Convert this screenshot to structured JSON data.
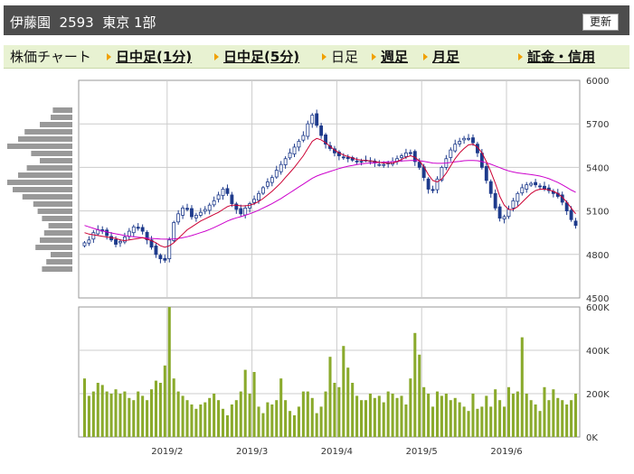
{
  "header": {
    "title": "伊藤園  2593  東京 1部",
    "refresh_label": "更新"
  },
  "nav": {
    "chart_label": "株価チャート",
    "items": [
      {
        "label": "日中足(1分)",
        "link": true
      },
      {
        "label": "日中足(5分)",
        "link": true
      },
      {
        "label": "日足",
        "link": false
      },
      {
        "label": "週足",
        "link": true
      },
      {
        "label": "月足",
        "link": true
      },
      {
        "label": "証金・信用",
        "link": true
      }
    ]
  },
  "colors": {
    "up": "#ffffff",
    "down": "#1e3b8c",
    "ma_short": "#cc0033",
    "ma_long": "#cc00cc",
    "volume": "#8aaa2c",
    "profile": "#999999",
    "grid": "#cccccc"
  },
  "chart_data": {
    "type": "candlestick",
    "x_labels": [
      "2019/2",
      "2019/3",
      "2019/4",
      "2019/5",
      "2019/6"
    ],
    "price_axis": {
      "min": 4500,
      "max": 6000,
      "ticks": [
        6000,
        5700,
        5400,
        5100,
        4800,
        4500
      ]
    },
    "volume_axis": {
      "min": 0,
      "max": 600000,
      "tick_labels": [
        "600K",
        "400K",
        "200K",
        "0K"
      ]
    },
    "price_close": [
      4880,
      4900,
      4950,
      4970,
      4960,
      4930,
      4900,
      4870,
      4890,
      4920,
      4960,
      4990,
      4980,
      4960,
      4900,
      4850,
      4800,
      4770,
      4760,
      4900,
      5020,
      5080,
      5120,
      5110,
      5060,
      5070,
      5090,
      5110,
      5140,
      5170,
      5210,
      5250,
      5220,
      5150,
      5110,
      5080,
      5120,
      5150,
      5180,
      5220,
      5260,
      5300,
      5330,
      5380,
      5420,
      5460,
      5500,
      5540,
      5580,
      5620,
      5700,
      5760,
      5690,
      5620,
      5560,
      5530,
      5500,
      5480,
      5470,
      5460,
      5450,
      5440,
      5440,
      5450,
      5440,
      5430,
      5420,
      5420,
      5430,
      5440,
      5460,
      5480,
      5500,
      5500,
      5440,
      5400,
      5330,
      5250,
      5240,
      5320,
      5400,
      5460,
      5520,
      5560,
      5580,
      5600,
      5600,
      5570,
      5500,
      5400,
      5310,
      5220,
      5120,
      5050,
      5060,
      5110,
      5170,
      5220,
      5260,
      5280,
      5290,
      5280,
      5270,
      5250,
      5240,
      5220,
      5200,
      5160,
      5100,
      5040,
      5000
    ],
    "ma_short": [
      4950,
      4940,
      4935,
      4930,
      4925,
      4920,
      4915,
      4910,
      4900,
      4895,
      4900,
      4905,
      4910,
      4915,
      4905,
      4895,
      4880,
      4860,
      4850,
      4860,
      4880,
      4910,
      4940,
      4970,
      4990,
      5010,
      5030,
      5045,
      5060,
      5075,
      5090,
      5110,
      5130,
      5140,
      5140,
      5135,
      5135,
      5140,
      5150,
      5165,
      5185,
      5210,
      5235,
      5265,
      5295,
      5330,
      5365,
      5400,
      5440,
      5480,
      5530,
      5580,
      5600,
      5590,
      5570,
      5545,
      5520,
      5500,
      5485,
      5475,
      5465,
      5455,
      5450,
      5448,
      5445,
      5440,
      5435,
      5430,
      5428,
      5430,
      5440,
      5455,
      5470,
      5480,
      5470,
      5445,
      5405,
      5350,
      5310,
      5300,
      5320,
      5360,
      5410,
      5460,
      5500,
      5530,
      5555,
      5560,
      5540,
      5500,
      5440,
      5370,
      5290,
      5200,
      5140,
      5110,
      5110,
      5130,
      5160,
      5190,
      5220,
      5240,
      5250,
      5250,
      5245,
      5235,
      5220,
      5195,
      5160,
      5120,
      5080
    ],
    "ma_long": [
      5000,
      4990,
      4980,
      4970,
      4962,
      4955,
      4948,
      4942,
      4936,
      4930,
      4926,
      4922,
      4918,
      4915,
      4912,
      4910,
      4908,
      4906,
      4905,
      4905,
      4907,
      4910,
      4915,
      4922,
      4930,
      4940,
      4950,
      4960,
      4972,
      4985,
      5000,
      5015,
      5030,
      5042,
      5052,
      5060,
      5070,
      5080,
      5092,
      5105,
      5120,
      5135,
      5150,
      5168,
      5185,
      5205,
      5225,
      5245,
      5265,
      5285,
      5305,
      5325,
      5340,
      5352,
      5362,
      5372,
      5382,
      5392,
      5400,
      5408,
      5414,
      5420,
      5424,
      5428,
      5430,
      5432,
      5434,
      5436,
      5438,
      5440,
      5442,
      5444,
      5446,
      5448,
      5448,
      5446,
      5442,
      5436,
      5430,
      5428,
      5428,
      5430,
      5434,
      5438,
      5442,
      5446,
      5448,
      5448,
      5446,
      5440,
      5432,
      5422,
      5410,
      5398,
      5386,
      5376,
      5368,
      5362,
      5358,
      5354,
      5350,
      5346,
      5340,
      5332,
      5322,
      5310,
      5296,
      5280,
      5262,
      5244,
      5228
    ],
    "volume": [
      270000,
      190000,
      210000,
      250000,
      240000,
      210000,
      200000,
      220000,
      200000,
      210000,
      180000,
      170000,
      210000,
      190000,
      170000,
      220000,
      260000,
      250000,
      330000,
      600000,
      270000,
      210000,
      190000,
      170000,
      150000,
      130000,
      150000,
      160000,
      180000,
      200000,
      170000,
      130000,
      100000,
      150000,
      170000,
      210000,
      310000,
      200000,
      300000,
      140000,
      110000,
      160000,
      150000,
      170000,
      270000,
      170000,
      120000,
      100000,
      140000,
      210000,
      210000,
      180000,
      110000,
      140000,
      210000,
      370000,
      250000,
      230000,
      420000,
      320000,
      250000,
      190000,
      170000,
      170000,
      200000,
      180000,
      190000,
      160000,
      210000,
      200000,
      180000,
      190000,
      150000,
      270000,
      480000,
      380000,
      230000,
      200000,
      140000,
      210000,
      190000,
      200000,
      170000,
      180000,
      160000,
      140000,
      120000,
      200000,
      130000,
      140000,
      190000,
      140000,
      220000,
      170000,
      140000,
      230000,
      200000,
      210000,
      460000,
      200000,
      170000,
      150000,
      120000,
      230000,
      170000,
      220000,
      180000,
      170000,
      150000,
      170000,
      200000
    ],
    "volume_profile": [
      0.18,
      0.2,
      0.3,
      0.44,
      0.5,
      0.6,
      0.38,
      0.3,
      0.42,
      0.5,
      0.6,
      0.55,
      0.46,
      0.36,
      0.32,
      0.28,
      0.22,
      0.26,
      0.3,
      0.34,
      0.2,
      0.24,
      0.28
    ]
  }
}
